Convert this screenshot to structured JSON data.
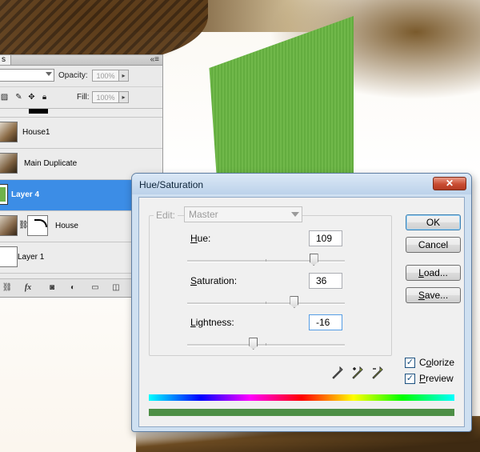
{
  "layers_panel": {
    "tab_label": "s",
    "menu_icon": "panel-menu-icon",
    "blend_mode_value": "",
    "opacity_label": "Opacity:",
    "opacity_value": "100%",
    "lock_icons": [
      "lock-transparent-icon",
      "lock-image-icon",
      "lock-position-icon",
      "lock-all-icon"
    ],
    "fill_label": "Fill:",
    "fill_value": "100%",
    "layers": [
      {
        "name": "House1",
        "selected": false
      },
      {
        "name": "Main Duplicate",
        "selected": false
      },
      {
        "name": "Layer 4",
        "selected": true
      },
      {
        "name": "House",
        "selected": false,
        "has_mask": true
      },
      {
        "name": "Layer 1",
        "selected": false
      }
    ],
    "footer_icons": [
      "link-layers-icon",
      "fx-icon",
      "add-mask-icon",
      "adjustment-layer-icon",
      "new-group-icon",
      "new-layer-icon"
    ],
    "fx_label": "fx"
  },
  "dialog": {
    "title": "Hue/Saturation",
    "close_glyph": "✕",
    "edit_label": "Edit:",
    "edit_value": "Master",
    "hue": {
      "label_u": "H",
      "label_rest": "ue:",
      "value": "109",
      "fraction": 0.8028
    },
    "saturation": {
      "label_u": "S",
      "label_rest": "aturation:",
      "value": "36",
      "fraction": 0.68
    },
    "lightness": {
      "label_u": "L",
      "label_rest": "ightness:",
      "value": "-16",
      "fraction": 0.42
    },
    "buttons": {
      "ok": "OK",
      "cancel": "Cancel",
      "load_u": "L",
      "load_rest": "oad...",
      "save_u": "S",
      "save_rest": "ave..."
    },
    "eyedroppers": [
      "eyedropper-icon",
      "eyedropper-plus-icon",
      "eyedropper-minus-icon"
    ],
    "colorize": {
      "label_u": "o",
      "label_pre": "C",
      "label_rest": "lorize",
      "checked": true
    },
    "preview": {
      "label_u": "P",
      "label_rest": "review",
      "checked": true
    },
    "result_color": "#4d8f46",
    "check_glyph": "✓"
  }
}
